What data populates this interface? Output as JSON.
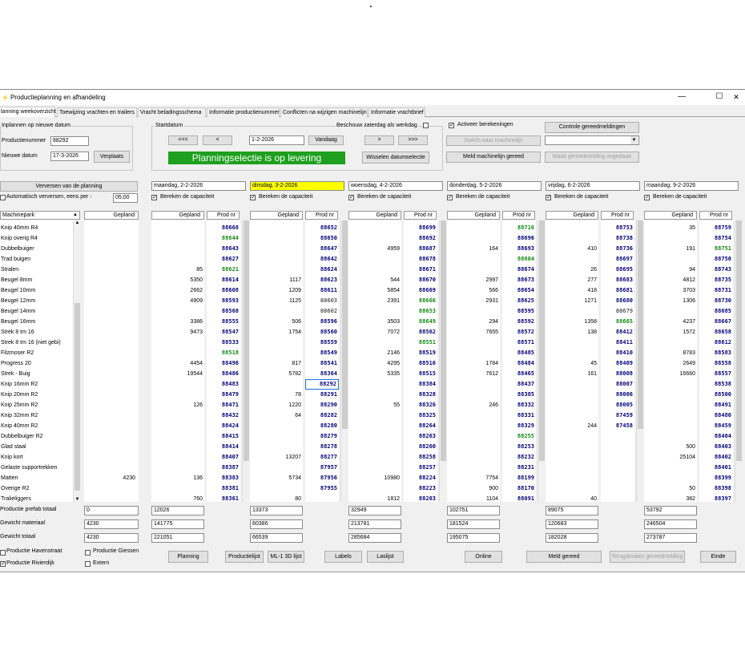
{
  "window": {
    "title": "Productieplanning en afhandeling",
    "icon": "app-icon",
    "minimize": "—",
    "maximize": "☐",
    "close": "✕"
  },
  "tabs": [
    "lanning weekoverzicht",
    "Toewijzing vrachten en trailers",
    "Vracht beladingsschema",
    "Informatie productienummer",
    "Conflicten na wijzigen machinelijn",
    "Informatie vrachtbrief"
  ],
  "inplannen": {
    "caption": "Inplannen op nieuwe datum",
    "productienummer_label": "Productienummer",
    "productienummer": "88292",
    "nieuwe_datum_label": "Nieuwe datum",
    "nieuwe_datum": "17-3-2026",
    "verplaats": "Verplaats"
  },
  "startdatum": {
    "caption": "Startdatum",
    "beschouw": "Beschouw zaterdag als werkdag",
    "beschouw_checked": false,
    "date": "1-2-2026",
    "prev_week": "<<<",
    "prev": "<",
    "vandaag": "Vandaag",
    "next": ">",
    "next_week": ">>>",
    "banner": "Planningselectie is op levering",
    "wisselen": "Wisselen datumselectie"
  },
  "right_controls": {
    "activeer": "Activeer berekeningen",
    "activeer_checked": true,
    "controle": "Controle gereedmeldingen",
    "switch": "Switch naar machinelijn",
    "meld_machinelijn": "Meld machinelijn gereed",
    "maak_ongedaan": "Maak gereedmelding ongedaan",
    "combo_value": ""
  },
  "verversen": "Verversen van de planning",
  "auto_verversen": {
    "label": "Automatisch verversen, eens per :",
    "value": "05:00",
    "checked": false
  },
  "machine_header": "Machinepark",
  "gepland_header": "Gepland",
  "prod_header": "Prod nr",
  "bereken_label": "Bereken de capaciteit",
  "machines": [
    "Knip 40mm R4",
    "Knip overig R4",
    "Dubbelbuiger",
    "Trad buigen",
    "Stralen",
    "Beugel 8mm",
    "Beugel 10mm",
    "Beugel 12mm",
    "Beugel 14mm",
    "Beugel 16mm",
    "Strek 8 tm 16",
    "Strek 8 tm 16 (niet gebi)",
    "Filzmoser R2",
    "Progress 20",
    "Strek - Buig",
    "Knip 16mm R2",
    "Knip 20mm R2",
    "Knip 25mm R2",
    "Knip 32mm R2",
    "Knip 40mm R2",
    "Dubbelbuiger R2",
    "Glad staal",
    "Knip kort",
    "Gelaste supportrekken",
    "Matten",
    "Overige R2",
    "Tralieliggers"
  ],
  "base_gepland": {
    "24": "4230"
  },
  "days": [
    {
      "date": "maandag, 2-2-2026",
      "highlight": false,
      "bereken": true,
      "gepland": {
        "4": "85",
        "5": "5350",
        "6": "2662",
        "7": "4909",
        "9": "3386",
        "10": "9473",
        "13": "4454",
        "14": "19544",
        "17": "126",
        "24": "136",
        "26": "760"
      },
      "prod": [
        "88668",
        "88644",
        "88643",
        "88627",
        "88621",
        "88614",
        "88608",
        "88593",
        "88568",
        "88555",
        "88547",
        "88533",
        "88518",
        "88496",
        "88486",
        "88483",
        "88479",
        "88471",
        "88432",
        "88424",
        "88415",
        "88414",
        "88407",
        "88387",
        "88383",
        "88381",
        "88361",
        "88301",
        "88192",
        "88152",
        "88151"
      ],
      "green": [
        1,
        4,
        12
      ],
      "black": [],
      "totals": [
        "12026",
        "141775",
        "221051"
      ]
    },
    {
      "date": "dinsdag, 3-2-2026",
      "highlight": true,
      "bereken": true,
      "gepland": {
        "5": "1117",
        "6": "1209",
        "7": "1125",
        "9": "506",
        "10": "1754",
        "13": "817",
        "14": "5782",
        "16": "78",
        "17": "1220",
        "18": "64",
        "22": "13207",
        "24": "5734",
        "26": "80"
      },
      "prod": [
        "88652",
        "88650",
        "88647",
        "88642",
        "88624",
        "88623",
        "88611",
        "88603",
        "88602",
        "88596",
        "88560",
        "88559",
        "88549",
        "88541",
        "88364",
        "88292",
        "88291",
        "88290",
        "88282",
        "88280",
        "88279",
        "88278",
        "88277",
        "87957",
        "87956",
        "87955"
      ],
      "green": [],
      "black": [
        7,
        8
      ],
      "selected": 15,
      "totals": [
        "13373",
        "60386",
        "66539"
      ]
    },
    {
      "date": "woensdag, 4-2-2026",
      "highlight": false,
      "bereken": true,
      "gepland": {
        "2": "4959",
        "5": "544",
        "6": "5854",
        "7": "2391",
        "9": "3503",
        "10": "7072",
        "12": "2146",
        "13": "4295",
        "14": "5335",
        "17": "55",
        "24": "10980",
        "26": "1812"
      },
      "prod": [
        "88699",
        "88692",
        "88687",
        "88678",
        "88671",
        "88670",
        "88669",
        "88666",
        "88653",
        "88649",
        "88562",
        "88551",
        "88519",
        "88516",
        "88515",
        "88384",
        "88328",
        "88326",
        "88325",
        "88264",
        "88263",
        "88260",
        "88258",
        "88257",
        "88224",
        "88223",
        "88203",
        "88118",
        "88013",
        "88000",
        "87999"
      ],
      "green": [
        7,
        8,
        9,
        11
      ],
      "black": [],
      "totals": [
        "32949",
        "213781",
        "285684"
      ]
    },
    {
      "date": "donderdag, 5-2-2026",
      "highlight": false,
      "bereken": true,
      "gepland": {
        "2": "164",
        "5": "2997",
        "6": "566",
        "7": "2931",
        "9": "294",
        "10": "7655",
        "13": "1784",
        "14": "7612",
        "17": "246",
        "24": "7754",
        "25": "900",
        "26": "1104"
      },
      "prod": [
        "88716",
        "88696",
        "88693",
        "88604",
        "88674",
        "88673",
        "88654",
        "88625",
        "88595",
        "88592",
        "88572",
        "88571",
        "88485",
        "88484",
        "88465",
        "88437",
        "88385",
        "88332",
        "88331",
        "88329",
        "88255",
        "88253",
        "88232",
        "88231",
        "88199",
        "88170",
        "88091",
        "88073",
        "88072",
        "88027",
        "87977"
      ],
      "green": [
        0,
        3,
        20
      ],
      "black": [],
      "totals": [
        "102751",
        "181524",
        "195075"
      ]
    },
    {
      "date": "vrijdag, 6-2-2026",
      "highlight": false,
      "bereken": true,
      "gepland": {
        "2": "410",
        "4": "26",
        "5": "277",
        "6": "418",
        "7": "1271",
        "9": "1358",
        "10": "138",
        "13": "45",
        "14": "161",
        "19": "244",
        "26": "40"
      },
      "prod": [
        "88753",
        "88738",
        "88736",
        "88697",
        "88695",
        "88683",
        "88681",
        "88680",
        "88679",
        "88665",
        "88412",
        "88411",
        "88410",
        "88409",
        "88008",
        "88007",
        "88006",
        "88005",
        "87459",
        "87458"
      ],
      "green": [
        9
      ],
      "black": [
        8
      ],
      "totals": [
        "89075",
        "120683",
        "182028"
      ]
    },
    {
      "date": "maandag, 9-2-2026",
      "highlight": false,
      "bereken": true,
      "gepland": {
        "0": "35",
        "2": "191",
        "4": "94",
        "5": "4812",
        "6": "3703",
        "7": "1306",
        "9": "4237",
        "10": "1572",
        "12": "8783",
        "13": "2649",
        "14": "16660",
        "21": "500",
        "22": "25104",
        "25": "50",
        "26": "382"
      },
      "prod": [
        "88759",
        "88754",
        "88751",
        "88750",
        "88743",
        "88735",
        "88731",
        "88730",
        "88685",
        "88667",
        "88658",
        "88612",
        "88583",
        "88558",
        "88557",
        "88538",
        "88500",
        "88491",
        "88480",
        "88459",
        "88404",
        "88403",
        "88402",
        "88401",
        "88399",
        "88398",
        "88397",
        "88396",
        "88287",
        "88193",
        "88154"
      ],
      "green": [
        2
      ],
      "black": [],
      "totals": [
        "53792",
        "246504",
        "273787"
      ]
    }
  ],
  "totals_labels": [
    "Productie prefab totaal",
    "Gewicht materiaal",
    "Gewicht totaal"
  ],
  "totals_base": [
    "0",
    "4230",
    "4230"
  ],
  "bottom": {
    "havenstraat": "Productie Havenstraat",
    "havenstraat_checked": false,
    "giessen": "Productie Giessen",
    "giessen_checked": false,
    "rivierdijk": "Productie Rivierdijk",
    "rivierdijk_checked": true,
    "extern": "Extern",
    "extern_checked": false,
    "planning": "Planning",
    "productielijst": "Productielijst",
    "ml1": "ML-1 3D lijst",
    "labels": "Labels",
    "laslijst": "Laslijst",
    "online": "Online",
    "meld_gereed": "Meld gereed",
    "terugdraaien": "Terugdraaien gereedmelding",
    "einde": "Einde"
  },
  "colors": {
    "banner_bg": "#1ea01e",
    "highlight": "#ffff00",
    "prod_blue": "#00007a",
    "prod_green": "#138a13"
  }
}
